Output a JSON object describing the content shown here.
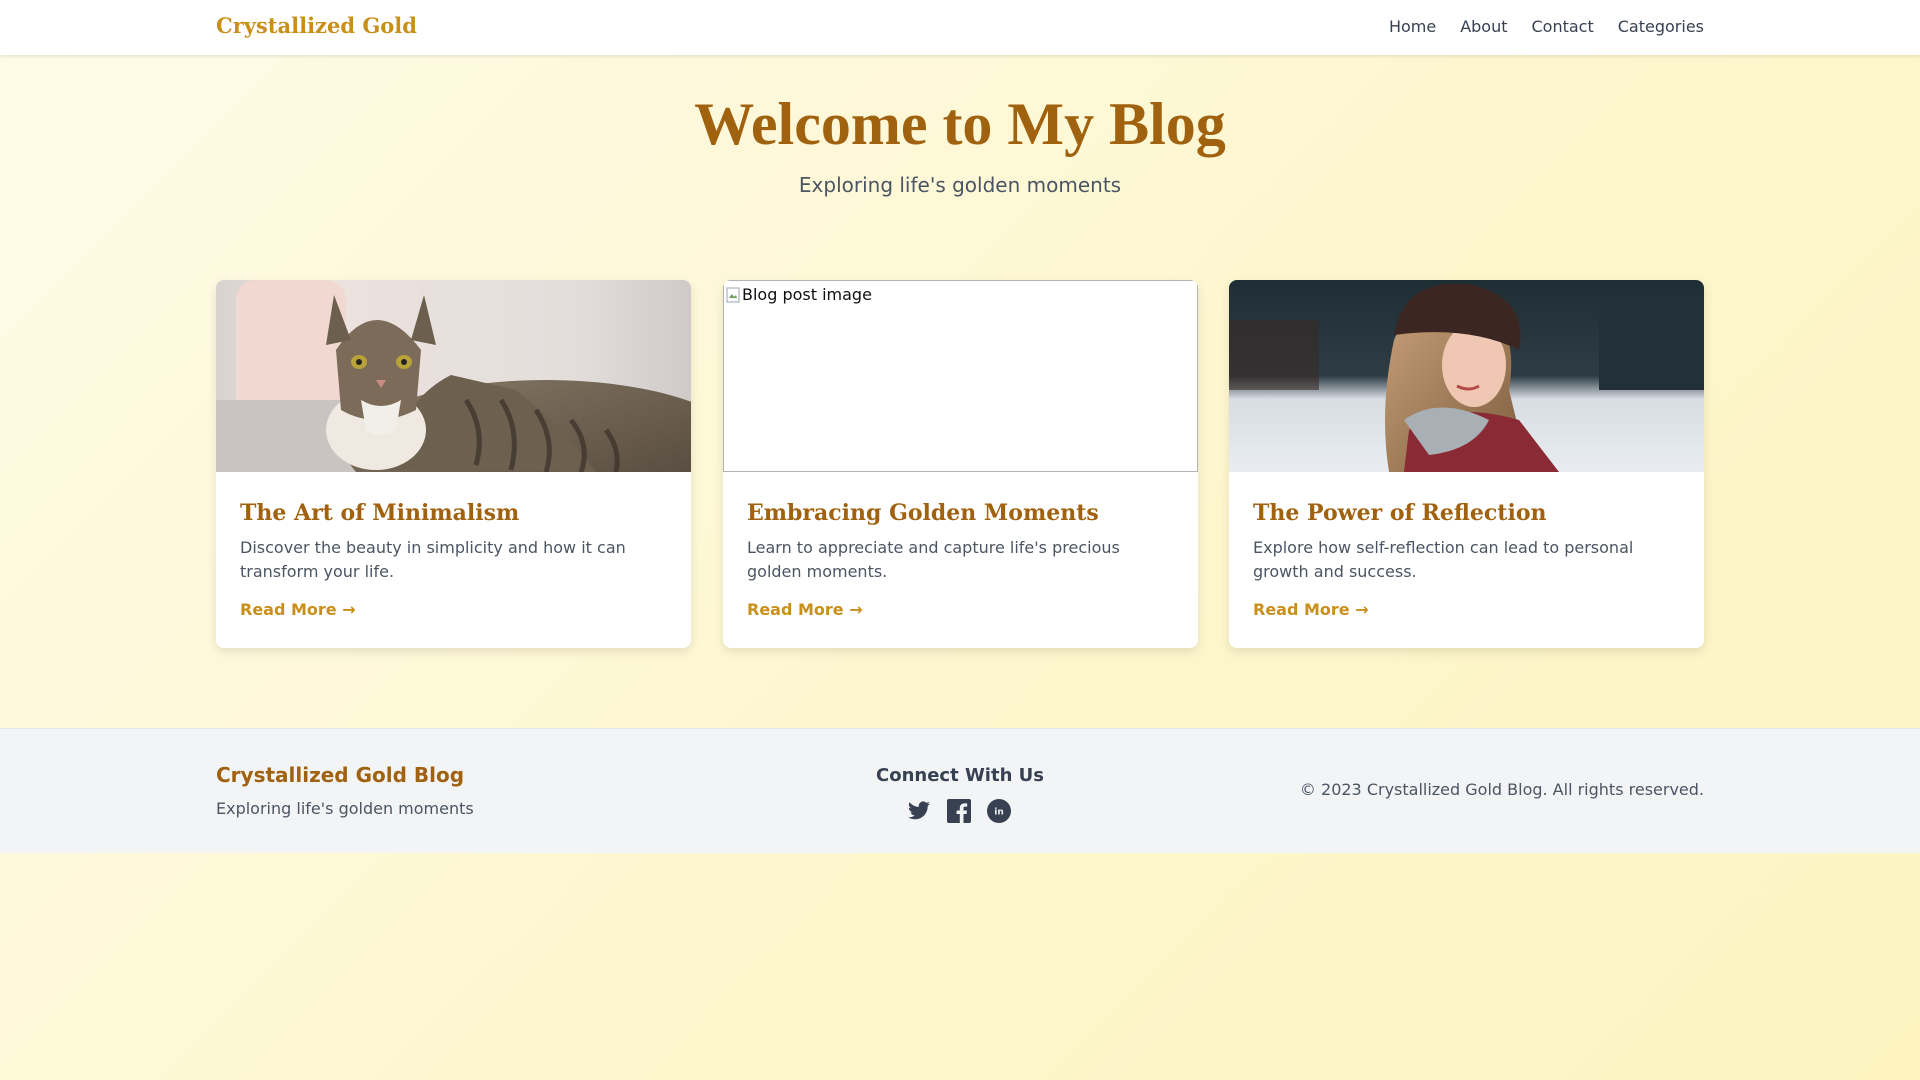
{
  "nav": {
    "brand": "Crystallized Gold",
    "links": [
      "Home",
      "About",
      "Contact",
      "Categories"
    ]
  },
  "hero": {
    "title": "Welcome to My Blog",
    "subtitle": "Exploring life's golden moments"
  },
  "posts": [
    {
      "image": "cat-photo",
      "title": "The Art of Minimalism",
      "excerpt": "Discover the beauty in simplicity and how it can transform your life.",
      "link": "Read More →"
    },
    {
      "image": "broken-image",
      "image_alt": "Blog post image",
      "title": "Embracing Golden Moments",
      "excerpt": "Learn to appreciate and capture life's precious golden moments.",
      "link": "Read More →"
    },
    {
      "image": "woman-winter-photo",
      "title": "The Power of Reflection",
      "excerpt": "Explore how self-reflection can lead to personal growth and success.",
      "link": "Read More →"
    }
  ],
  "footer": {
    "brand": "Crystallized Gold Blog",
    "tagline": "Exploring life's golden moments",
    "connect_heading": "Connect With Us",
    "social_icons": [
      "twitter-icon",
      "facebook-icon",
      "linkedin-icon"
    ],
    "copyright": "© 2023 Crystallized Gold Blog. All rights reserved."
  },
  "colors": {
    "accent": "#c8901a",
    "heading": "#a1620f",
    "text": "#374151",
    "muted": "#4b5563",
    "footer_bg": "#f3f4f6"
  }
}
